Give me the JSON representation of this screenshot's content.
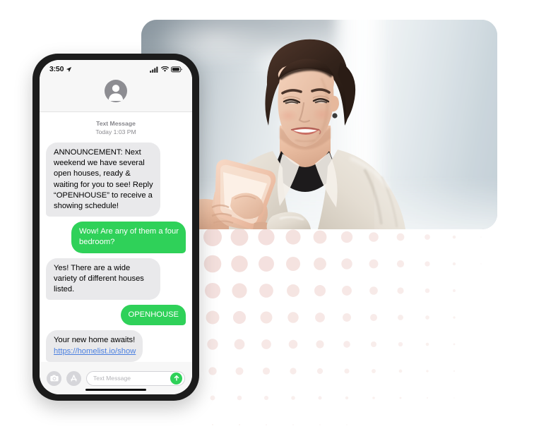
{
  "scene": {
    "background_color": "#ffffff",
    "accent_green": "#2fd159",
    "bubble_gray": "#e9e9eb",
    "link_blue": "#4a7fe0",
    "dot_color": "#f3dedb"
  },
  "photo": {
    "alt": "Smiling businesswoman in a cream blazer reading a text message on her smartphone in a bright office",
    "subject": "businesswoman-with-phone",
    "background": "blurred-office-interior"
  },
  "decor": {
    "dot_grid": {
      "name": "dot-grid-pattern",
      "color": "#f3dedb",
      "columns": 11,
      "rows": 8,
      "spacing": 38,
      "max_radius": 13
    }
  },
  "phone": {
    "status_bar": {
      "time": "3:50",
      "location_icon": "location-arrow-icon",
      "signal_icon": "cellular-signal-icon",
      "wifi_icon": "wifi-icon",
      "battery_icon": "battery-icon"
    },
    "nav": {
      "avatar_icon": "contact-avatar-icon"
    },
    "conversation": {
      "meta_title": "Text Message",
      "meta_timestamp": "Today 1:03 PM",
      "messages": [
        {
          "direction": "in",
          "text": "ANNOUNCEMENT: Next weekend we have several open houses, ready & waiting for you to see! Reply “OPENHOUSE” to receive a showing schedule!"
        },
        {
          "direction": "out",
          "text": "Wow! Are any of them a four bedroom?"
        },
        {
          "direction": "in",
          "text": "Yes! There are a wide variety of different houses listed."
        },
        {
          "direction": "out",
          "text": "OPENHOUSE"
        },
        {
          "direction": "in",
          "text": "Your new home awaits!",
          "link": "https://homelist.io/show"
        }
      ]
    },
    "input_bar": {
      "camera_icon": "camera-icon",
      "appstore_icon": "app-store-icon",
      "placeholder": "Text Message",
      "send_icon": "send-arrow-up-icon"
    },
    "home_indicator": "home-indicator-bar"
  }
}
